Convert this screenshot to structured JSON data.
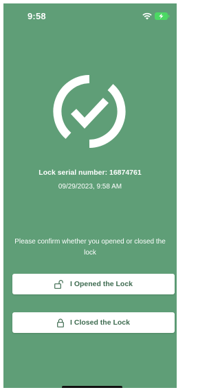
{
  "status_bar": {
    "time": "9:58",
    "icons": [
      "wifi-icon",
      "battery-charging-icon"
    ],
    "battery_color": "#4cd964"
  },
  "colors": {
    "background": "#5f9e77",
    "button_text": "#3e6b50"
  },
  "confirmation": {
    "icon": "checkmark-circle-icon",
    "serial_text": "Lock serial number: 16874761",
    "datetime": "09/29/2023, 9:58 AM",
    "prompt": "Please confirm whether you opened or closed the lock"
  },
  "buttons": {
    "opened": {
      "label": "I Opened the Lock",
      "icon": "unlocked-padlock-icon"
    },
    "closed": {
      "label": "I Closed the Lock",
      "icon": "locked-padlock-icon"
    }
  }
}
